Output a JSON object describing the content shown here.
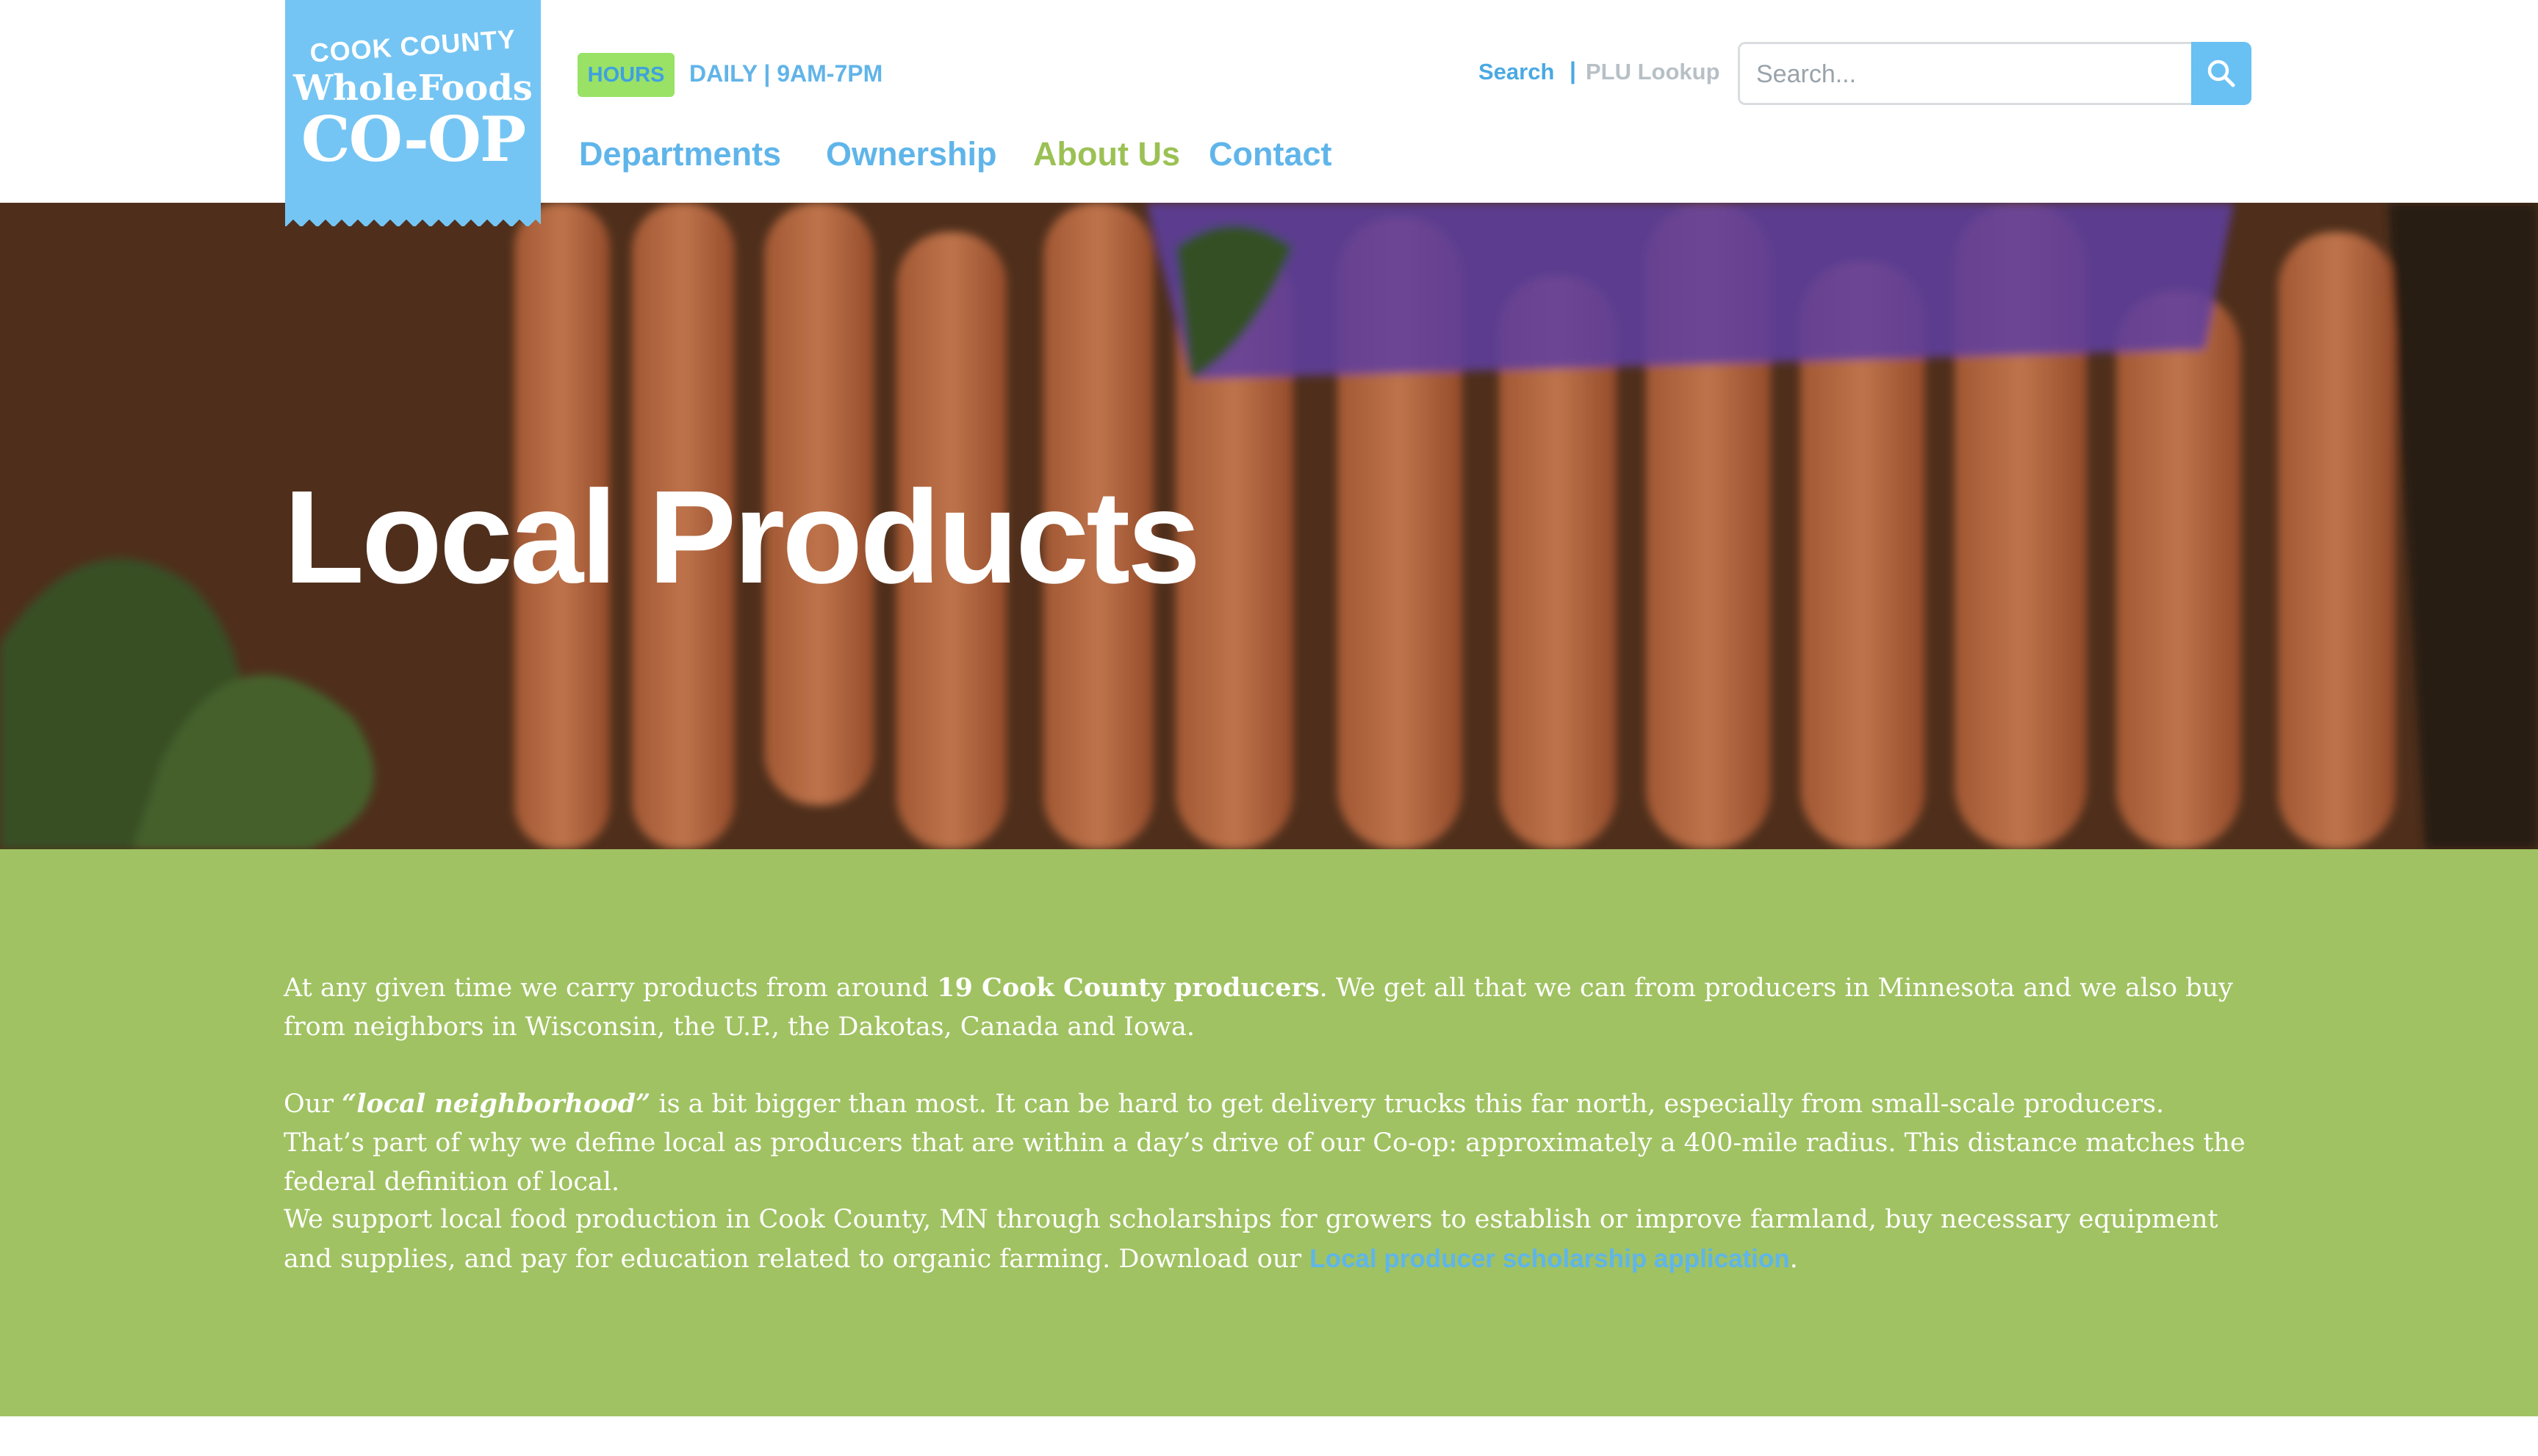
{
  "brand": {
    "line1": "COOK COUNTY",
    "line2": "WholeFoods",
    "line3": "CO-OP"
  },
  "hours": {
    "badge": "HOURS",
    "text": "DAILY | 9AM-7PM"
  },
  "utility": {
    "search_link": "Search",
    "separator": "|",
    "plu_link": "PLU Lookup"
  },
  "search": {
    "placeholder": "Search..."
  },
  "nav": {
    "items": [
      {
        "label": "Departments"
      },
      {
        "label": "Ownership"
      },
      {
        "label": "About Us"
      },
      {
        "label": "Contact"
      }
    ]
  },
  "hero": {
    "title": "Local Products"
  },
  "content": {
    "p1_pre": "At any given time we carry products from around ",
    "p1_bold": "19 Cook County producers",
    "p1_post": ". We get all that we can from producers in Minnesota and we also buy from neighbors in Wisconsin, the U.P., the Dakotas, Canada and Iowa.",
    "p2_pre": "Our ",
    "p2_bold": "“local neighborhood”",
    "p2_post": " is a bit bigger than most. It can be hard to get delivery trucks this far north, especially from small-scale producers. That’s part of why we define local as producers that are within a day’s drive of our Co-op: approximately a 400-mile radius. This distance matches the federal definition of local.",
    "p3_pre": "We support local food production in Cook County, MN through scholarships for growers to establish or improve farmland, buy necessary equipment and supplies, and pay for education related to organic farming. Download our ",
    "p3_link": "Local producer scholarship application",
    "p3_post": "."
  },
  "colors": {
    "brand_blue": "#74c5f3",
    "nav_blue": "#5fb5ea",
    "nav_active_green": "#9bc154",
    "section_green": "#a0c262",
    "hours_green": "#99e266"
  }
}
